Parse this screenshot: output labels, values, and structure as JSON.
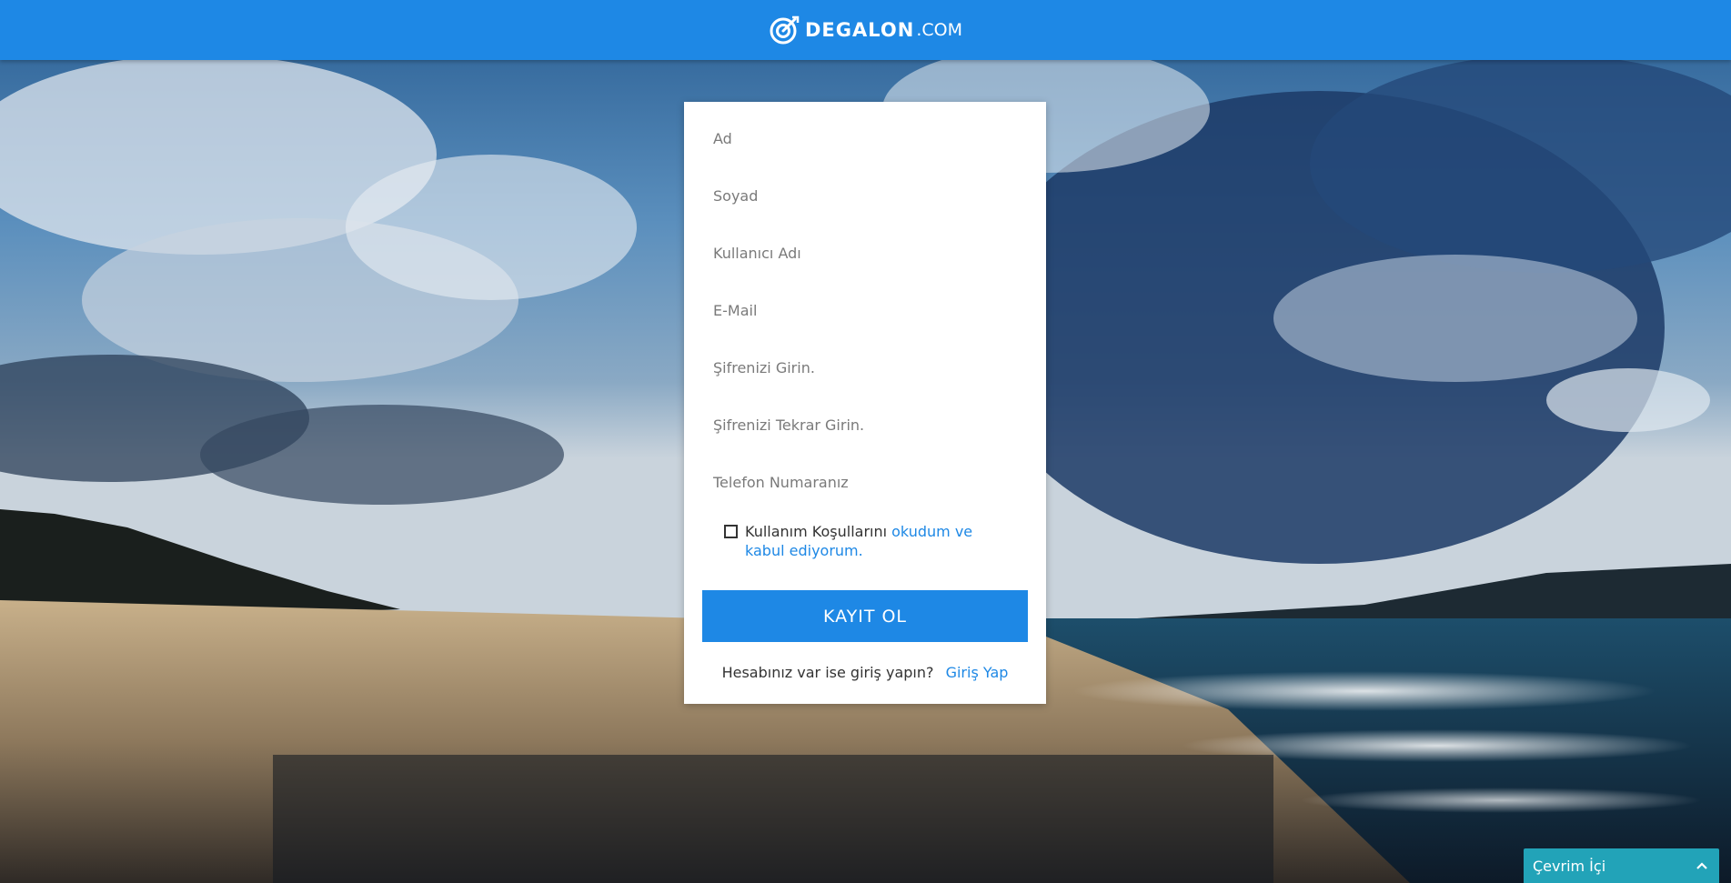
{
  "header": {
    "brand_name": "DEGALON",
    "brand_tld": ".COM",
    "logo_icon": "target-dart-icon"
  },
  "form": {
    "first_name_placeholder": "Ad",
    "last_name_placeholder": "Soyad",
    "username_placeholder": "Kullanıcı Adı",
    "email_placeholder": "E-Mail",
    "password_placeholder": "Şifrenizi Girin.",
    "password_repeat_placeholder": "Şifrenizi Tekrar Girin.",
    "phone_placeholder": "Telefon Numaranız",
    "terms_prefix": "Kullanım Koşullarını ",
    "terms_link": "okudum ve kabul ediyorum.",
    "submit_label": "KAYIT OL",
    "login_prompt": "Hesabınız var ise giriş yapın?",
    "login_link": "Giriş Yap"
  },
  "chat": {
    "status_label": "Çevrim İçi",
    "toggle_icon": "chevron-up-icon"
  },
  "colors": {
    "accent": "#1e88e5",
    "chat": "#22a3b8"
  }
}
